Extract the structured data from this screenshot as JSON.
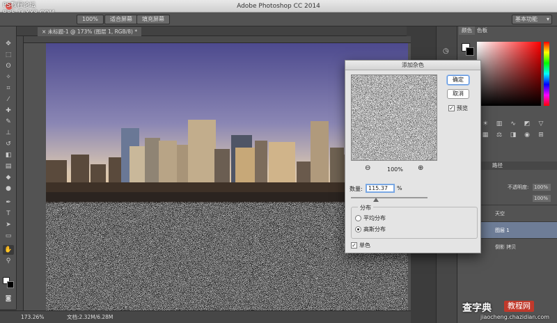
{
  "window": {
    "title": "Adobe Photoshop CC 2014"
  },
  "watermark_top": {
    "line1": "PS教程论坛",
    "line2": "BBS.16XX8.COM"
  },
  "options_bar": {
    "buttons": [
      "100%",
      "适合屏幕",
      "填充屏幕"
    ],
    "workspace": "基本功能"
  },
  "document": {
    "tab_label": "未标题-1 @ 173% (图层 1, RGB/8) *",
    "zoom_status": "173.26%",
    "doc_status": "文档:2.32M/6.28M"
  },
  "panels": {
    "color_tabs": [
      "颜色",
      "色板"
    ],
    "layers_tab": "路径",
    "opacity_label": "不透明度:",
    "opacity_value": "100%",
    "fill_value": "100%",
    "layers": [
      {
        "name": "天空",
        "selected": false
      },
      {
        "name": "图层 1",
        "selected": true
      },
      {
        "name": "倒影 拷贝",
        "selected": false
      }
    ]
  },
  "dialog": {
    "title": "添加杂色",
    "ok_label": "确定",
    "cancel_label": "取消",
    "preview_label": "预览",
    "preview_checked": true,
    "zoom_value": "100%",
    "amount_label": "数量:",
    "amount_value": "115.37",
    "amount_unit": "%",
    "distribution_label": "分布",
    "distribution_options": [
      "平均分布",
      "高斯分布"
    ],
    "distribution_selected": 1,
    "mono_label": "单色",
    "mono_checked": true
  },
  "watermark_bottom": {
    "brand": "查字典",
    "tag": "教程网",
    "url": "jiaocheng.chazidian.com"
  },
  "colors": {
    "accent": "#5a8fd8",
    "ui_dark": "#535353"
  }
}
